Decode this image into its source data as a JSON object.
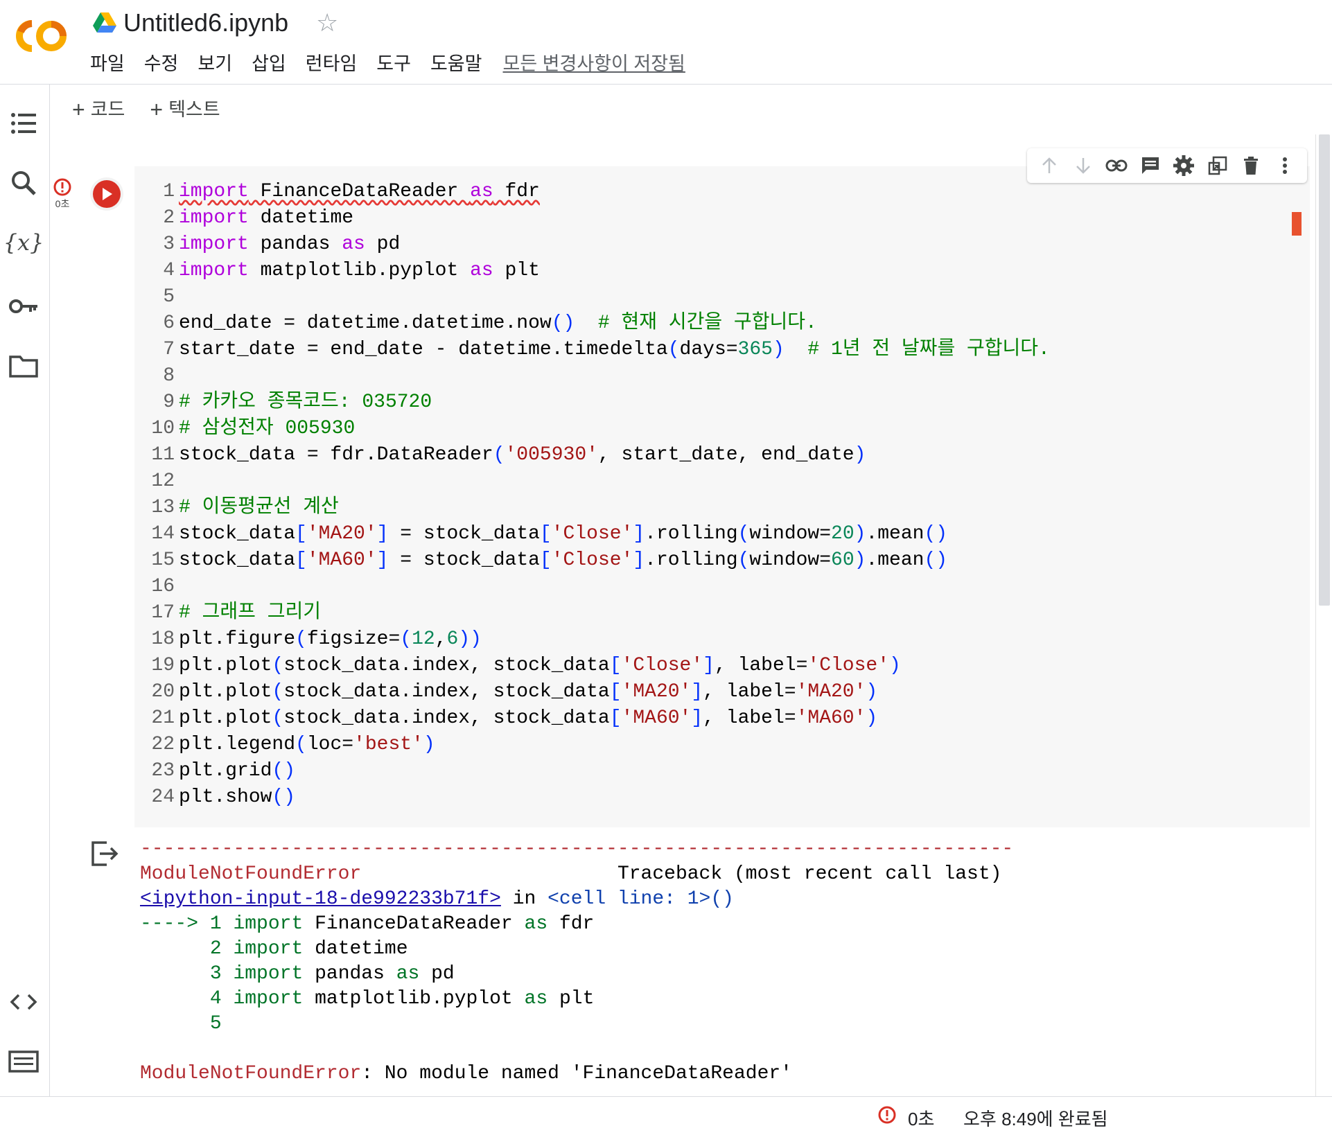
{
  "header": {
    "title": "Untitled6.ipynb",
    "menu": [
      "파일",
      "수정",
      "보기",
      "삽입",
      "런타임",
      "도구",
      "도움말"
    ],
    "save_status": "모든 변경사항이 저장됨"
  },
  "toolbar": {
    "add_code": "코드",
    "add_text": "텍스트"
  },
  "sidebar_icons": [
    "table-of-contents-icon",
    "search-icon",
    "variables-icon",
    "secrets-key-icon",
    "folder-icon",
    "code-snippets-icon",
    "command-palette-icon"
  ],
  "cell": {
    "exec_time": "0초",
    "code_lines": [
      "import FinanceDataReader as fdr",
      "import datetime",
      "import pandas as pd",
      "import matplotlib.pyplot as plt",
      "",
      "end_date = datetime.datetime.now()  # 현재 시간을 구합니다.",
      "start_date = end_date - datetime.timedelta(days=365)  # 1년 전 날짜를 구합니다.",
      "",
      "# 카카오 종목코드: 035720",
      "# 삼성전자 005930",
      "stock_data = fdr.DataReader('005930', start_date, end_date)",
      "",
      "# 이동평균선 계산",
      "stock_data['MA20'] = stock_data['Close'].rolling(window=20).mean()",
      "stock_data['MA60'] = stock_data['Close'].rolling(window=60).mean()",
      "",
      "# 그래프 그리기",
      "plt.figure(figsize=(12,6))",
      "plt.plot(stock_data.index, stock_data['Close'], label='Close')",
      "plt.plot(stock_data.index, stock_data['MA20'], label='MA20')",
      "plt.plot(stock_data.index, stock_data['MA60'], label='MA60')",
      "plt.legend(loc='best')",
      "plt.grid()",
      "plt.show()"
    ]
  },
  "output": {
    "separator": "---------------------------------------------------------------------------",
    "error_name": "ModuleNotFoundError",
    "traceback_header": "Traceback (most recent call last)",
    "input_link": "<ipython-input-18-de992233b71f>",
    "in_word": "in",
    "cell_ref": "<cell line: 1>()",
    "arrow": "---->",
    "error_message": "No module named 'FinanceDataReader'"
  },
  "status_bar": {
    "time": "0초",
    "message": "오후 8:49에 완료됨"
  },
  "colors": {
    "keyword": "#af00db",
    "comment": "#008000",
    "string": "#a31515",
    "number": "#098658",
    "error": "#d93025"
  }
}
